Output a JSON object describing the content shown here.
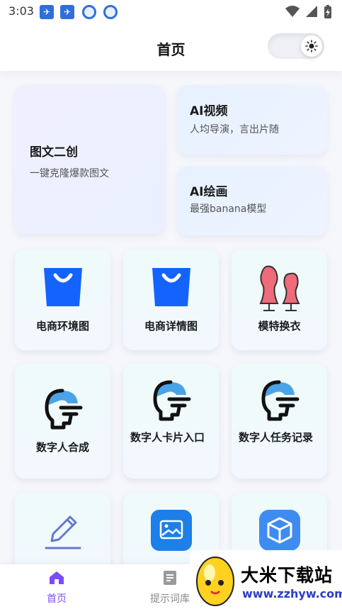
{
  "status_bar": {
    "time": "3:03"
  },
  "header": {
    "title": "首页"
  },
  "cards": {
    "big": {
      "title": "图文二创",
      "subtitle": "一键克隆爆款图文"
    },
    "ai_video": {
      "title": "AI视频",
      "subtitle": "人均导演，言出片随"
    },
    "ai_paint": {
      "title": "AI绘画",
      "subtitle": "最强banana模型"
    }
  },
  "tiles": [
    {
      "label": "电商环境图",
      "icon": "shopping-bag-icon"
    },
    {
      "label": "电商详情图",
      "icon": "shopping-bag-icon"
    },
    {
      "label": "模特换衣",
      "icon": "mannequin-icon"
    },
    {
      "label": "数字人合成",
      "icon": "digital-human-icon"
    },
    {
      "label": "数字人卡片入口",
      "icon": "digital-human-icon"
    },
    {
      "label": "数字人任务记录",
      "icon": "digital-human-icon"
    },
    {
      "label": "",
      "icon": "pencil-icon"
    },
    {
      "label": "",
      "icon": "image-icon"
    },
    {
      "label": "",
      "icon": "cube-icon"
    }
  ],
  "bottom_nav": {
    "home": "首页",
    "prompts": "提示词库"
  },
  "watermark": {
    "title": "大米下载站",
    "url": "www.zzhyw.com"
  },
  "colors": {
    "accent": "#7b4cff",
    "bag_blue": "#1463ff",
    "human_blue": "#4aa3e6"
  }
}
